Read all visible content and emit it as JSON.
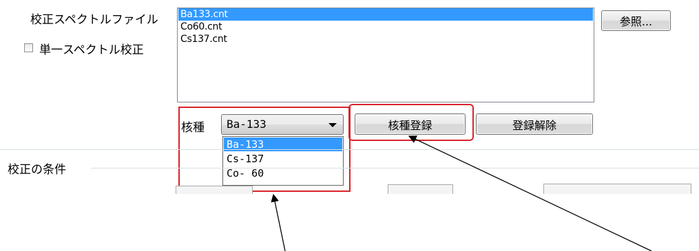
{
  "calibration": {
    "spectrum_file_label": "校正スペクトルファイル",
    "single_spectrum_label": "単一スペクトル校正",
    "single_spectrum_checked": false,
    "browse_button": "参照...",
    "files": [
      {
        "name": "Ba133.cnt",
        "selected": true
      },
      {
        "name": "Co60.cnt",
        "selected": false
      },
      {
        "name": "Cs137.cnt",
        "selected": false
      }
    ]
  },
  "nuclide": {
    "label": "核種",
    "selected_value": "Ba-133",
    "options": [
      {
        "label": "Ba-133",
        "selected": true
      },
      {
        "label": "Cs-137",
        "selected": false
      },
      {
        "label": "Co- 60",
        "selected": false
      }
    ],
    "register_button": "核種登録",
    "unregister_button": "登録解除"
  },
  "conditions": {
    "section_label": "校正の条件"
  },
  "colors": {
    "selection": "#3399ff",
    "highlight_box": "#d9232b"
  }
}
